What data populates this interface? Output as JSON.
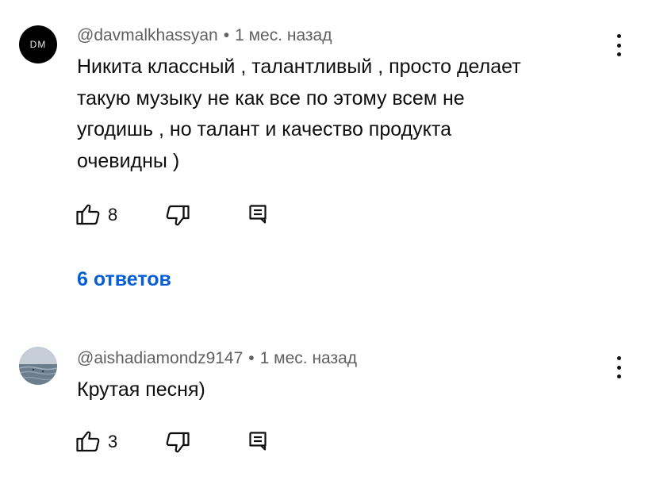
{
  "comments": [
    {
      "avatar_text": "DM",
      "author": "@davmalkhassyan",
      "separator": "•",
      "time": "1 мес. назад",
      "lines": [
        "Никита классный , талантливый , просто делает",
        "такую музыку не как все по этому всем не",
        "угодишь , но талант и качество продукта",
        "очевидны )"
      ],
      "likes": "8",
      "replies_label": "6 ответов"
    },
    {
      "author": "@aishadiamondz9147",
      "separator": "•",
      "time": "1 мес. назад",
      "lines": [
        "Крутая песня)"
      ],
      "likes": "3"
    }
  ],
  "icons": {
    "like": "thumb-up-icon",
    "dislike": "thumb-down-icon",
    "reply": "reply-icon",
    "menu": "more-vertical-icon"
  },
  "colors": {
    "link": "#065fd4",
    "meta": "#606060",
    "text": "#0f0f0f"
  }
}
